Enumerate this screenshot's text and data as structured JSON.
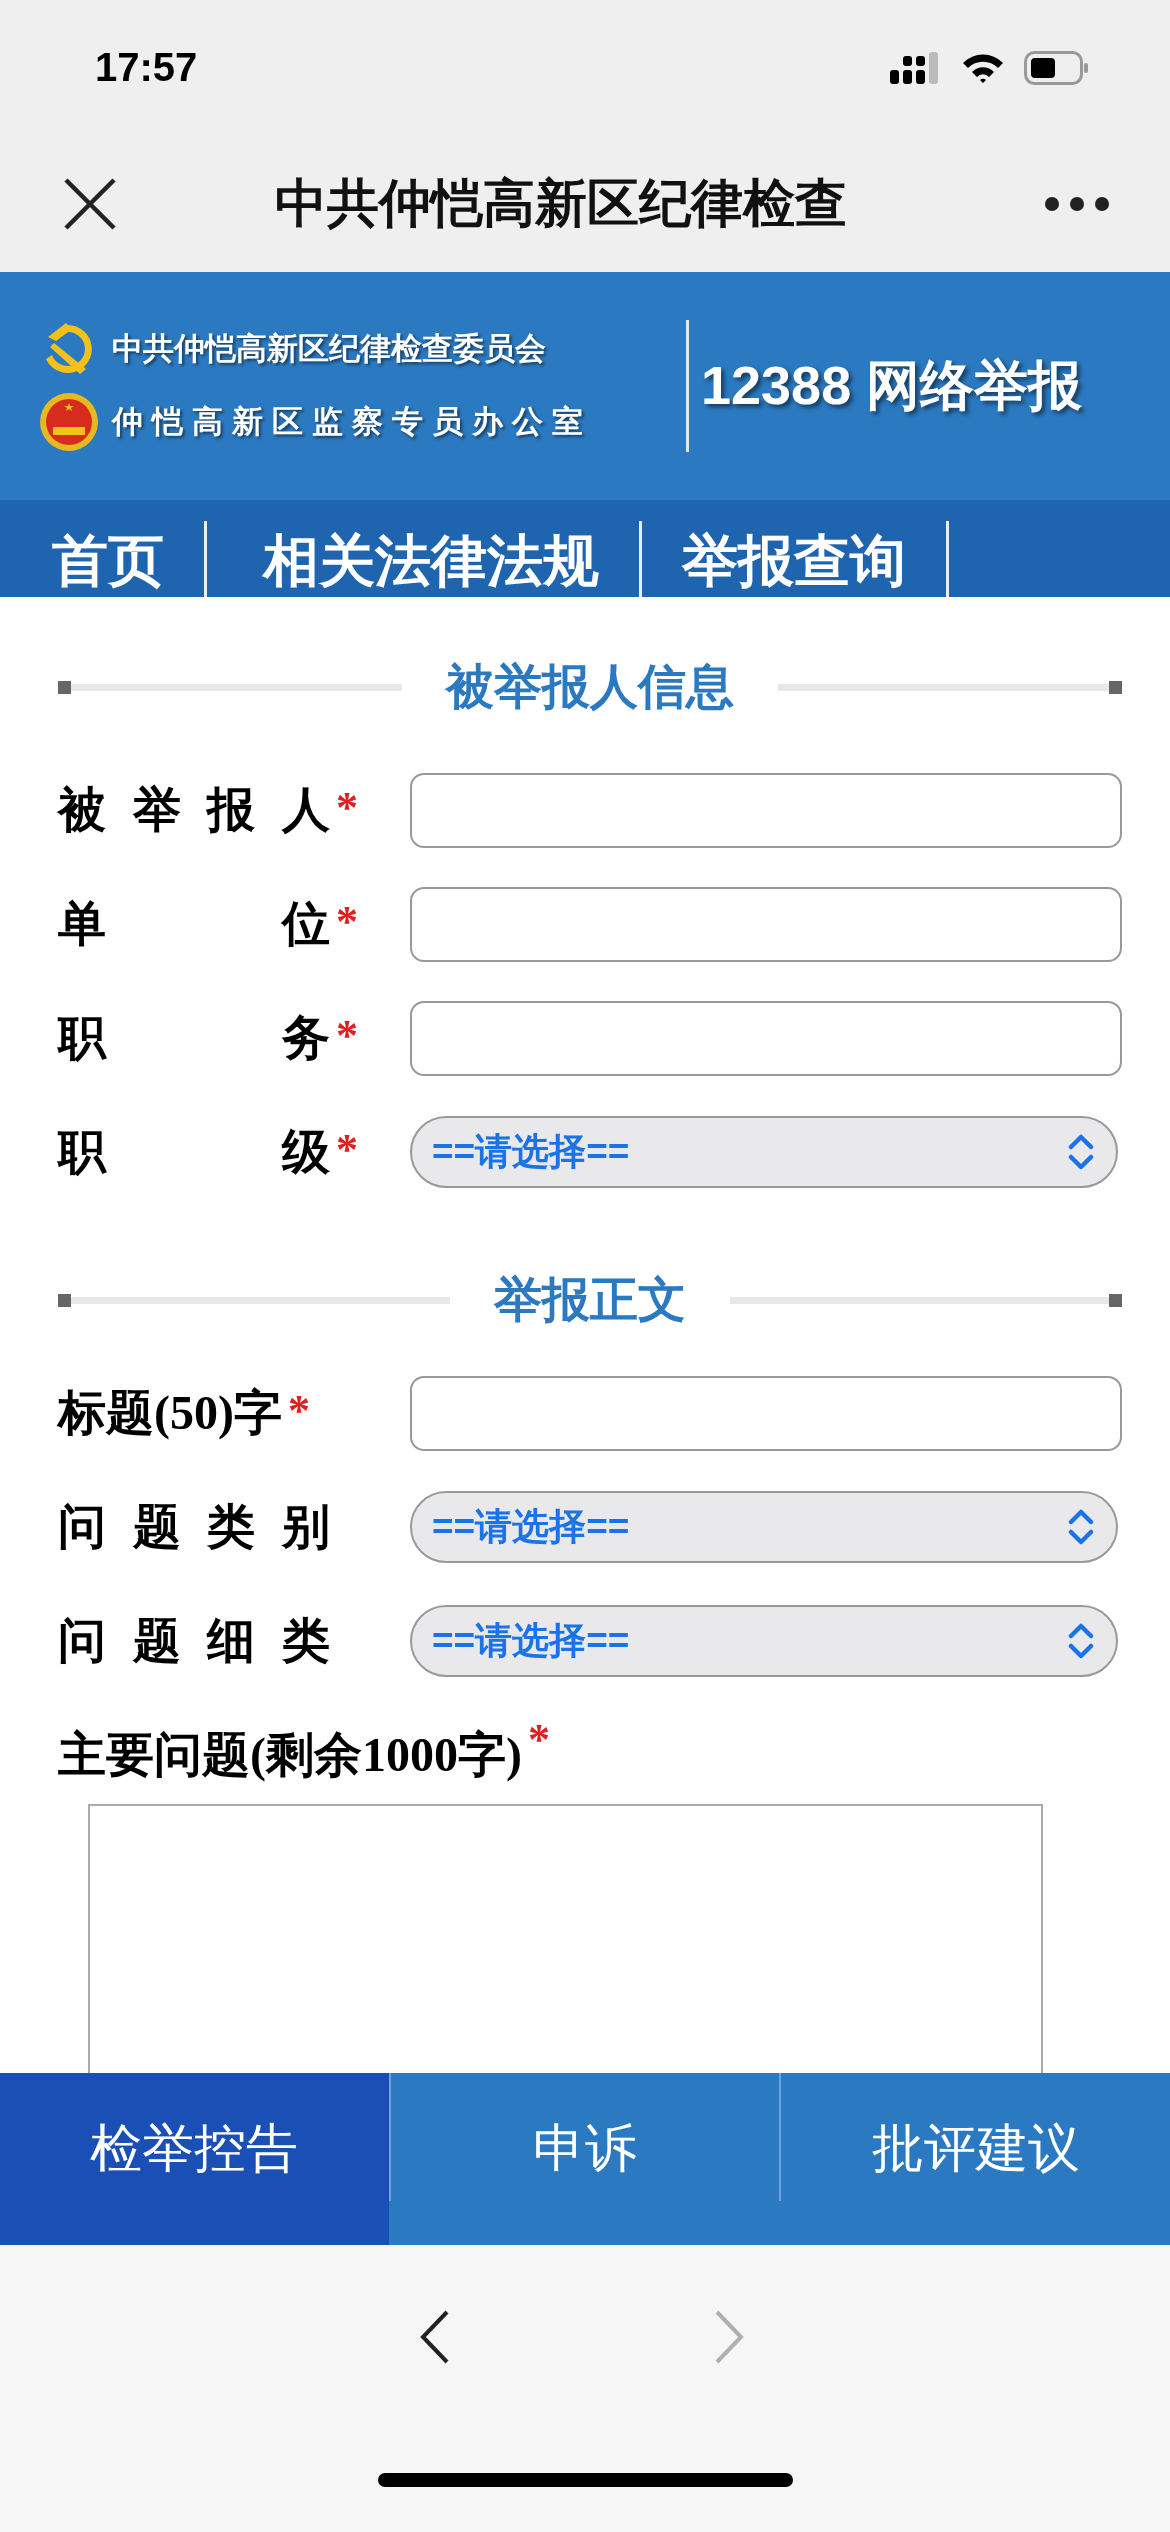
{
  "status_bar": {
    "time": "17:57"
  },
  "nav_bar": {
    "title": "中共仲恺高新区纪律检查"
  },
  "banner": {
    "org_lines": [
      "中共仲恺高新区纪律检查委员会",
      "仲恺高新区监察专员办公室"
    ],
    "hotline": "12388 网络举报"
  },
  "site_nav": [
    {
      "label": "首页"
    },
    {
      "label": "相关法律法规"
    },
    {
      "label": "举报查询"
    }
  ],
  "sections": [
    {
      "title": "被举报人信息",
      "fields": [
        {
          "kind": "text",
          "label": "被举报人",
          "required_mark": "*",
          "justified": true
        },
        {
          "kind": "text",
          "label": "单位",
          "required_mark": "*",
          "justified": true
        },
        {
          "kind": "text",
          "label": "职务",
          "required_mark": "*",
          "justified": true
        },
        {
          "kind": "select",
          "label": "职级",
          "required_mark": "*",
          "justified": true,
          "value": "==请选择=="
        }
      ]
    },
    {
      "title": "举报正文",
      "fields": [
        {
          "kind": "text",
          "label": "标题(50)字",
          "required_mark": "*",
          "justified": false
        },
        {
          "kind": "select",
          "label": "问题类别",
          "justified": true,
          "value": "==请选择=="
        },
        {
          "kind": "select",
          "label": "问题细类",
          "justified": true,
          "value": "==请选择=="
        },
        {
          "kind": "textarea",
          "label": "主要问题(剩余1000字)",
          "required_mark": "*",
          "justified": false
        }
      ]
    }
  ],
  "bottom_tabs": [
    {
      "label": "检举控告",
      "selected": true
    },
    {
      "label": "申诉",
      "selected": false
    },
    {
      "label": "批评建议",
      "selected": false
    }
  ],
  "browser_toolbar": {
    "back": {
      "disabled": false
    },
    "forward": {
      "disabled": true
    }
  }
}
